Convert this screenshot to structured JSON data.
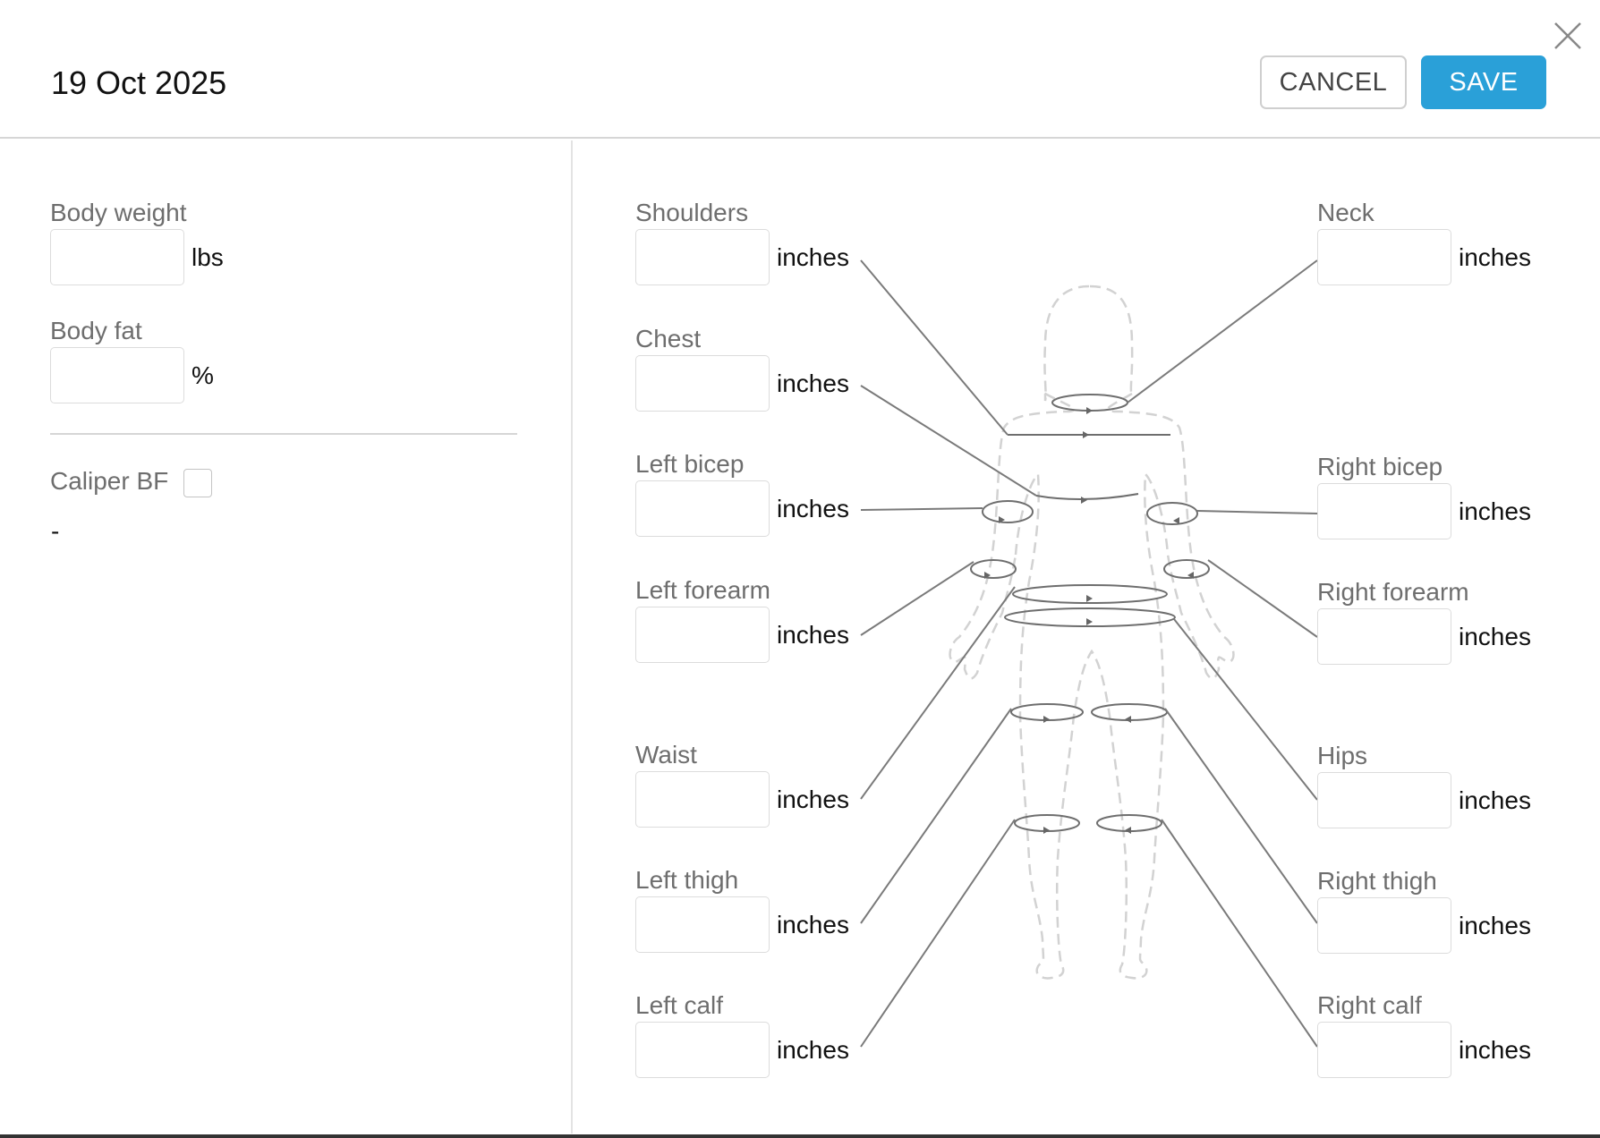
{
  "header": {
    "title": "19 Oct 2025",
    "cancel_label": "CANCEL",
    "save_label": "SAVE",
    "close_icon": "close-icon"
  },
  "left": {
    "body_weight": {
      "label": "Body weight",
      "value": "",
      "unit": "lbs"
    },
    "body_fat": {
      "label": "Body fat",
      "value": "",
      "unit": "%"
    },
    "caliper": {
      "label": "Caliper BF",
      "checked": false,
      "value": "-"
    }
  },
  "measurements": {
    "shoulders": {
      "label": "Shoulders",
      "value": "",
      "unit": "inches"
    },
    "chest": {
      "label": "Chest",
      "value": "",
      "unit": "inches"
    },
    "left_bicep": {
      "label": "Left bicep",
      "value": "",
      "unit": "inches"
    },
    "left_forearm": {
      "label": "Left forearm",
      "value": "",
      "unit": "inches"
    },
    "waist": {
      "label": "Waist",
      "value": "",
      "unit": "inches"
    },
    "left_thigh": {
      "label": "Left thigh",
      "value": "",
      "unit": "inches"
    },
    "left_calf": {
      "label": "Left calf",
      "value": "",
      "unit": "inches"
    },
    "neck": {
      "label": "Neck",
      "value": "",
      "unit": "inches"
    },
    "right_bicep": {
      "label": "Right bicep",
      "value": "",
      "unit": "inches"
    },
    "right_forearm": {
      "label": "Right forearm",
      "value": "",
      "unit": "inches"
    },
    "hips": {
      "label": "Hips",
      "value": "",
      "unit": "inches"
    },
    "right_thigh": {
      "label": "Right thigh",
      "value": "",
      "unit": "inches"
    },
    "right_calf": {
      "label": "Right calf",
      "value": "",
      "unit": "inches"
    }
  },
  "colors": {
    "accent": "#2aa0d8",
    "line": "#7a7a7a",
    "silhouette": "#cfcfcf"
  }
}
